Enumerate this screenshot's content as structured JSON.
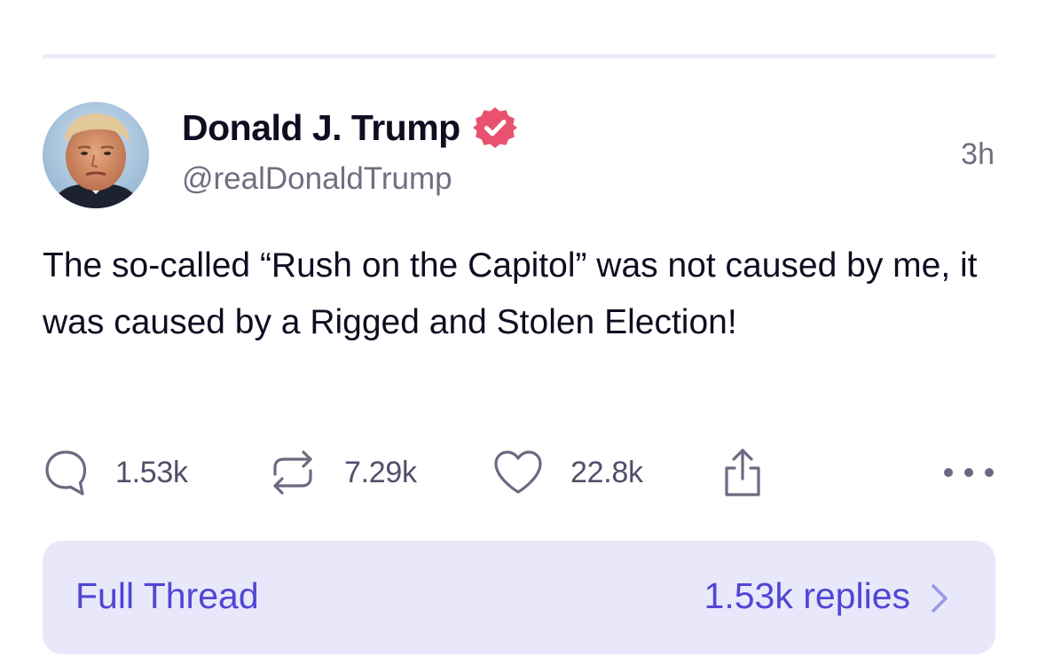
{
  "post": {
    "display_name": "Donald J. Trump",
    "handle": "@realDonaldTrump",
    "timestamp": "3h",
    "verified": true,
    "text": "The so-called “Rush on the Capitol” was not caused by me, it was caused by a Rigged and Stolen Election!"
  },
  "actions": {
    "replies": "1.53k",
    "reposts": "7.29k",
    "likes": "22.8k",
    "share_icon": "share-icon",
    "more_icon": "more-options-icon"
  },
  "thread": {
    "label": "Full Thread",
    "replies": "1.53k replies"
  },
  "colors": {
    "accent": "#5046d6",
    "verified_badge": "#e8526f",
    "thread_bar_bg": "#e8e8fa",
    "divider": "#ebebfa"
  }
}
